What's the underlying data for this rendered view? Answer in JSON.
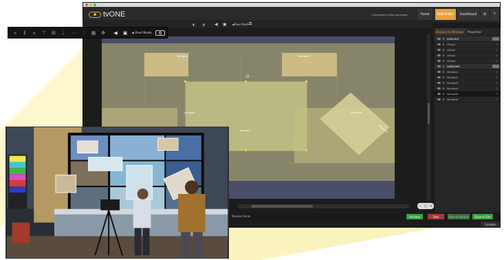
{
  "app": {
    "logo_text": "tvONE",
    "connection_status": "Connected to WA Connected",
    "nav": {
      "home": "Home",
      "wall_editor": "Wall Editor",
      "dashboard": "Dashboard",
      "settings_icon": "gear-icon",
      "help": "?"
    },
    "toolbar": {
      "pixel_mode_label": "Pixel Mode"
    },
    "canvas": {
      "windows": [
        {
          "label": "Window1"
        },
        {
          "label": "Window2"
        },
        {
          "label": "Window3"
        },
        {
          "label": "Window4"
        },
        {
          "label": "Window5"
        },
        {
          "label": "Window6"
        }
      ]
    },
    "right_panel": {
      "tabs": [
        "Displays & Windows",
        "Properties"
      ],
      "rows": [
        {
          "label": "DISPLAYS",
          "type": "group"
        },
        {
          "label": "vDisp1",
          "type": "item"
        },
        {
          "label": "vDisp2",
          "type": "item"
        },
        {
          "label": "vDisp3",
          "type": "item"
        },
        {
          "label": "vDisp4",
          "type": "item"
        },
        {
          "label": "WINDOWS",
          "type": "group"
        },
        {
          "label": "Window1",
          "type": "item"
        },
        {
          "label": "Window2",
          "type": "item"
        },
        {
          "label": "Window3",
          "type": "item"
        },
        {
          "label": "Window4",
          "type": "item"
        },
        {
          "label": "Window5",
          "type": "item",
          "selected": true
        },
        {
          "label": "Window6",
          "type": "item"
        }
      ]
    },
    "bottom": {
      "status_label": "Monitor Fonts",
      "preview": "Preview",
      "take": "Take",
      "save_to_device": "Save to Device",
      "save_to_file": "Save to File",
      "console": "Console"
    }
  },
  "floating_toolbar": {
    "pixel_mode_label": "Pixel Mode"
  },
  "colors": {
    "accent": "#e8a23a",
    "window_fill": "#c9c28a",
    "preview_green": "#3f9c46",
    "take_red": "#a23a3a"
  }
}
